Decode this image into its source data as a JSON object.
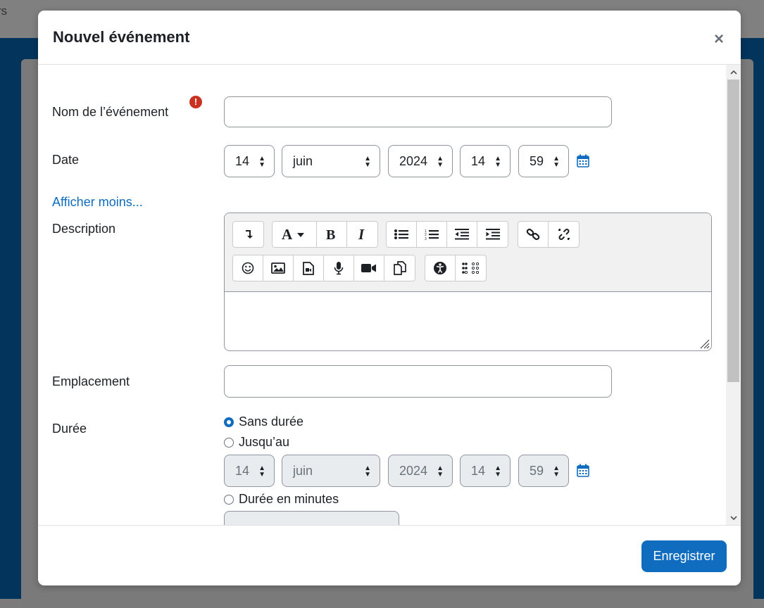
{
  "background": {
    "partial_text": "rs"
  },
  "modal": {
    "title": "Nouvel événement",
    "close_glyph": "×",
    "save_label": "Enregistrer"
  },
  "form": {
    "name_label": "Nom de l’événement",
    "required_glyph": "!",
    "name_value": "",
    "date_label": "Date",
    "date": {
      "day": "14",
      "month": "juin",
      "year": "2024",
      "hour": "14",
      "minute": "59"
    },
    "show_less_link": "Afficher moins...",
    "description_label": "Description",
    "location_label": "Emplacement",
    "location_value": "",
    "duration_label": "Durée",
    "duration_options": {
      "none": "Sans durée",
      "until": "Jusqu’au",
      "minutes": "Durée en minutes"
    },
    "duration_selected": "none",
    "until_date": {
      "day": "14",
      "month": "juin",
      "year": "2024",
      "hour": "14",
      "minute": "59"
    }
  },
  "editor_toolbar": {
    "row1": [
      [
        "collapse-icon"
      ],
      [
        "font-style-icon",
        "bold-icon",
        "italic-icon"
      ],
      [
        "unordered-list-icon",
        "ordered-list-icon",
        "outdent-icon",
        "indent-icon"
      ],
      [
        "link-icon",
        "unlink-icon"
      ]
    ],
    "row2": [
      [
        "emoji-icon",
        "image-icon",
        "media-icon",
        "record-audio-icon",
        "record-video-icon",
        "manage-files-icon"
      ],
      [
        "accessibility-checker-icon",
        "screenreader-helper-icon"
      ]
    ]
  },
  "colors": {
    "accent": "#0f6cbf",
    "required": "#ca3120",
    "disabled_bg": "#e9ecef"
  }
}
